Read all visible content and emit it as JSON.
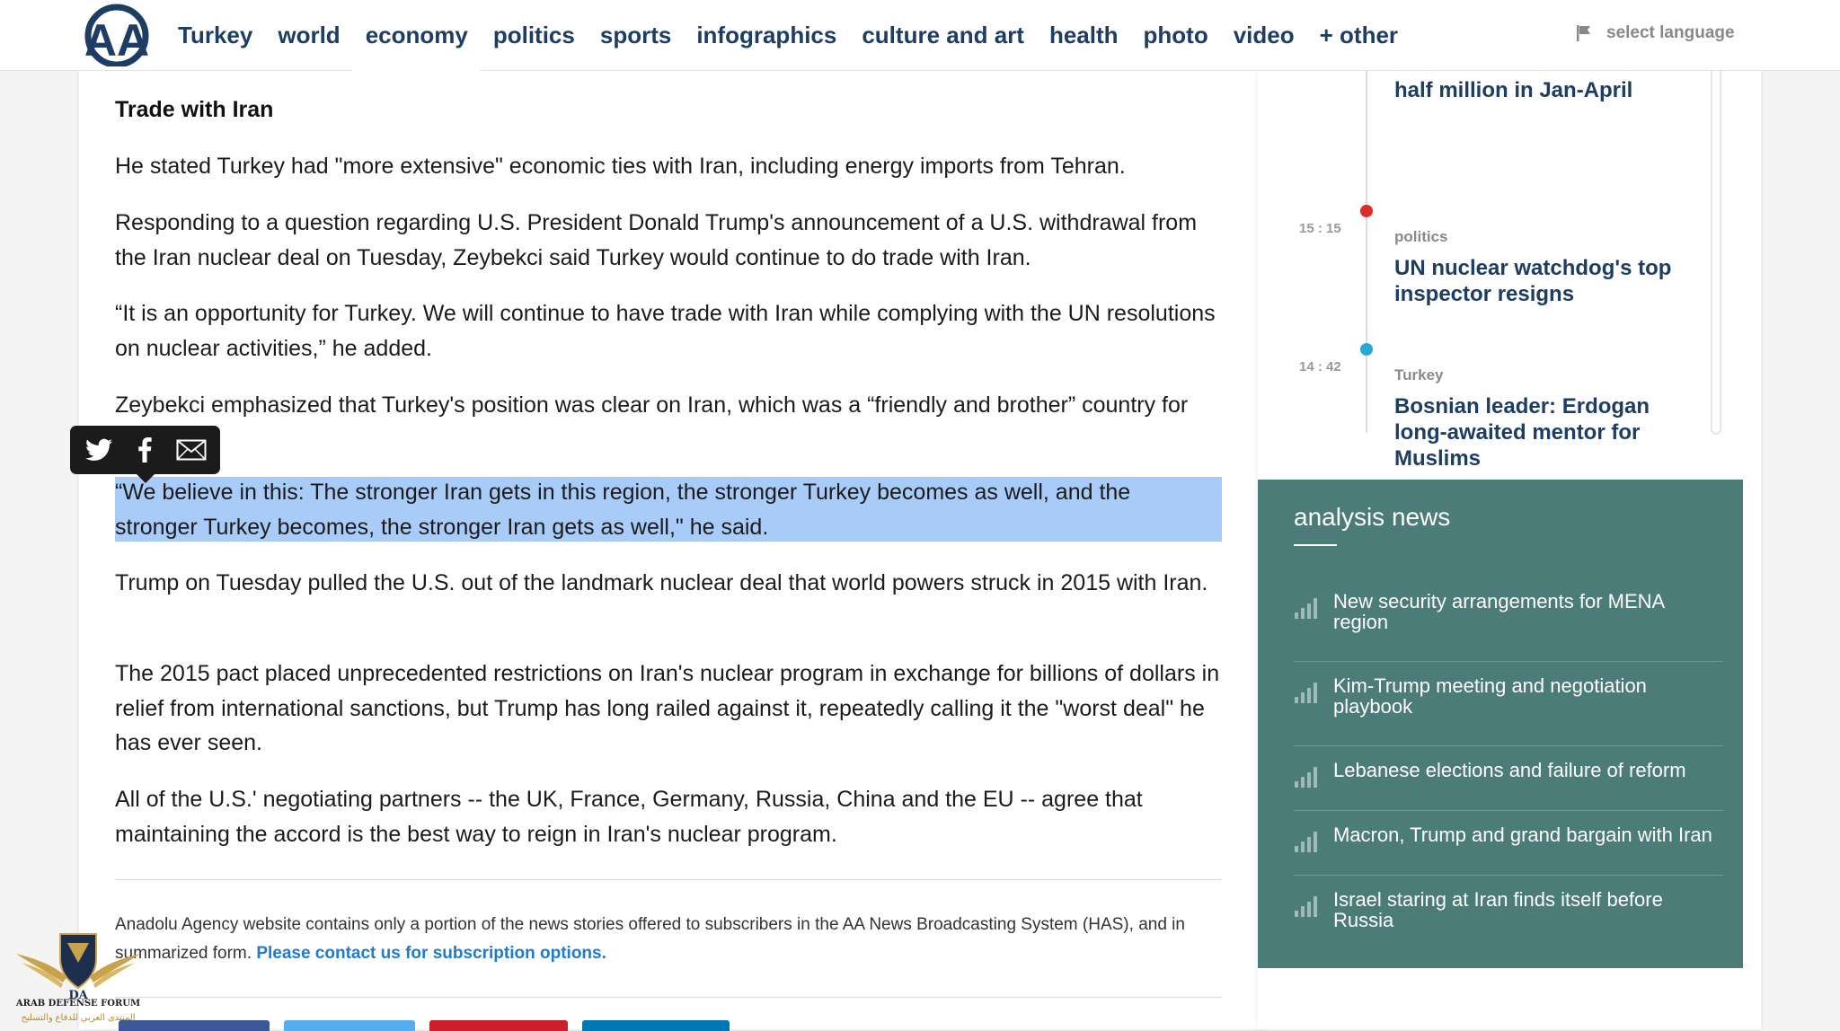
{
  "header": {
    "logo_text": "AA",
    "nav": [
      "Turkey",
      "world",
      "economy",
      "politics",
      "sports",
      "infographics",
      "culture and art",
      "health",
      "photo",
      "video",
      "+ other"
    ],
    "language": "select language"
  },
  "article": {
    "subhead": "Trade with Iran",
    "paragraphs": [
      "He stated Turkey had \"more extensive\" economic ties with Iran, including energy imports from Tehran.",
      "Responding to a question regarding U.S. President Donald Trump's announcement of a U.S. withdrawal from the Iran nuclear deal on Tuesday, Zeybekci said Turkey would continue to do trade with Iran.",
      "“It is an opportunity for Turkey. We will continue to have trade with Iran while complying with the UN resolutions on nuclear activities,” he added.",
      "Zeybekci emphasized that Turkey's position was clear on Iran, which was a “friendly and brother” country for",
      "“We believe in this: The stronger Iran gets in this region, the stronger Turkey  becomes as well, and the stronger Turkey becomes, the stronger Iran gets as well,\" he said.",
      "Trump on Tuesday pulled the U.S. out of the landmark nuclear deal that world powers struck in 2015 with Iran.",
      "The 2015 pact placed unprecedented restrictions on Iran's nuclear program in exchange for billions of dollars in relief from international sanctions, but Trump has long railed against it, repeatedly calling it the \"worst deal\" he has ever seen.",
      "All of the U.S.' negotiating partners -- the UK, France, Germany, Russia, China and the EU -- agree that maintaining the accord is the best way to reign in Iran's nuclear program."
    ],
    "footnote_text": "Anadolu Agency website contains only a portion of the news stories offered to subscribers in the AA News Broadcasting System (HAS), and in summarized form. ",
    "footnote_link": "Please contact us for subscription options.",
    "share_colors": [
      "#3b5998",
      "#55acee",
      "#cb2027",
      "#0077b5"
    ]
  },
  "share_popover": {
    "icons": [
      "twitter-icon",
      "facebook-icon",
      "mail-icon"
    ]
  },
  "sidebar": {
    "timeline": [
      {
        "time": "",
        "category": "",
        "title": "half million in Jan-April",
        "dot_color": ""
      },
      {
        "time": "15 : 15",
        "category": "politics",
        "title": "UN nuclear watchdog's top inspector resigns",
        "dot_color": "#e02b2b"
      },
      {
        "time": "14 : 42",
        "category": "Turkey",
        "title": "Bosnian leader: Erdogan long-awaited mentor for Muslims",
        "dot_color": "#27a9d6"
      }
    ],
    "analysis": {
      "title": "analysis news",
      "items": [
        "New security arrangements for MENA region",
        "Kim-Trump meeting and negotiation playbook",
        "Lebanese elections and failure of reform",
        "Macron, Trump and grand bargain with Iran",
        "Israel staring at Iran finds itself before Russia"
      ]
    }
  },
  "watermark": {
    "initials": "DA",
    "line1": "ARAB DEFENSE FORUM",
    "line2": "المنتدى العربي للدفاع والتسليح"
  },
  "colors": {
    "nav_text": "#1d3d63",
    "highlight": "#a8cbf8",
    "analysis_bg": "#4b7c78",
    "link": "#1d7bd0"
  }
}
